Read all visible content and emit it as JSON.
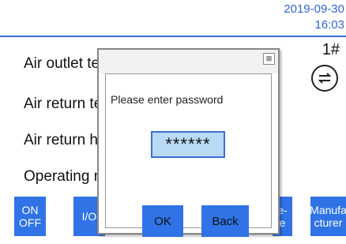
{
  "header": {
    "date": "2019-09-30",
    "time": "16:03"
  },
  "params": [
    {
      "label": "Air outlet te"
    },
    {
      "label": "Air return te"
    },
    {
      "label": "Air return hu"
    },
    {
      "label": "Operating n"
    }
  ],
  "status": {
    "unit_number": "1#",
    "swap_icon": "swap-arrows-icon"
  },
  "bottom_buttons": [
    {
      "label": "ON\nOFF"
    },
    {
      "label": "I/O"
    },
    {
      "label": "e-\ne"
    },
    {
      "label": "Manufa\ncturer"
    }
  ],
  "dialog": {
    "prompt": "Please enter password",
    "password_value": "******",
    "ok_label": "OK",
    "back_label": "Back",
    "close_glyph": "⊠"
  },
  "colors": {
    "accent": "#2f73e6",
    "input_bg": "#b9daf5",
    "datetime": "#2f63d6"
  }
}
